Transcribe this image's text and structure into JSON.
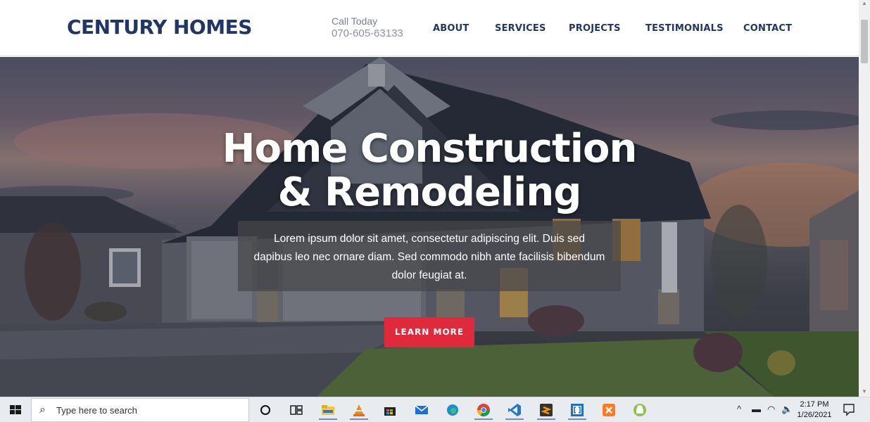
{
  "header": {
    "logo": "CENTURY HOMES",
    "call_label": "Call Today",
    "phone": "070-605-63133",
    "nav": [
      "ABOUT",
      "SERVICES",
      "PROJECTS",
      "TESTIMONIALS",
      "CONTACT"
    ]
  },
  "hero": {
    "title_line1": "Home Construction",
    "title_line2": "& Remodeling",
    "description": "Lorem ipsum dolor sit amet, consectetur adipiscing elit. Duis sed dapibus leo nec ornare diam. Sed commodo nibh ante facilisis bibendum dolor feugiat at.",
    "button": "LEARN MORE"
  },
  "taskbar": {
    "search_placeholder": "Type here to search",
    "time": "2:17 PM",
    "date": "1/26/2021",
    "apps": [
      "cortana-icon",
      "task-view-icon",
      "file-explorer-icon",
      "vlc-icon",
      "store-icon",
      "mail-icon",
      "edge-icon",
      "chrome-icon",
      "vscode-icon",
      "sublime-icon",
      "brackets-icon",
      "xampp-icon",
      "android-icon"
    ]
  },
  "colors": {
    "brand": "#223664",
    "accent": "#e0293b"
  }
}
